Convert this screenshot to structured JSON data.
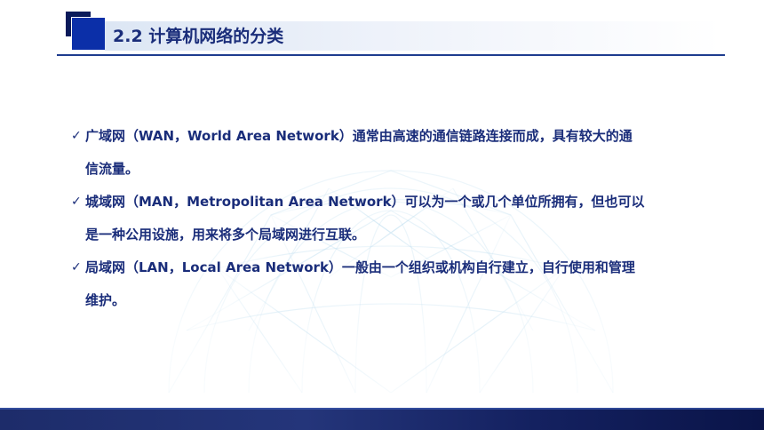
{
  "header": {
    "title": "2.2 计算机网络的分类"
  },
  "items": [
    {
      "lines": [
        "广域网（WAN，World Area Network）通常由高速的通信链路连接而成，具有较大的通",
        "信流量。"
      ]
    },
    {
      "lines": [
        "城域网（MAN，Metropolitan Area Network）可以为一个或几个单位所拥有，但也可以",
        "是一种公用设施，用来将多个局域网进行互联。"
      ]
    },
    {
      "lines": [
        "局域网（LAN，Local Area Network）一般由一个组织或机构自行建立，自行使用和管理",
        "维护。"
      ]
    }
  ],
  "icons": {
    "bullet": "check-icon"
  },
  "colors": {
    "title": "#1a2d7a",
    "accent": "#0b2fa8",
    "footer": "#1d2c6a"
  }
}
